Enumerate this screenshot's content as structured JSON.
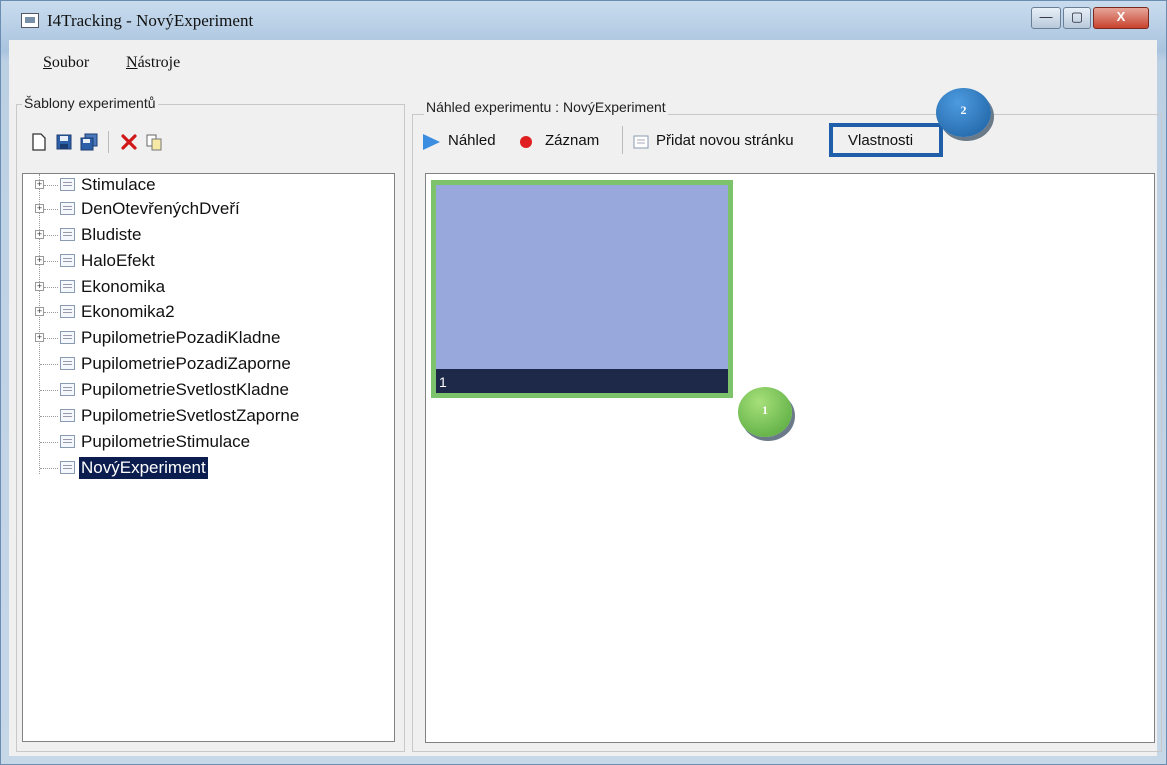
{
  "window": {
    "title": "I4Tracking - NovýExperiment",
    "minimize": "—",
    "maximize": "▢",
    "close": "X"
  },
  "menu": [
    {
      "label": "Soubor",
      "accel": "S",
      "rest": "oubor"
    },
    {
      "label": "Nástroje",
      "accel": "N",
      "rest": "ástroje"
    }
  ],
  "left_panel": {
    "title": "Šablony experimentů",
    "toolbar": [
      "new-icon",
      "save-icon",
      "save-all-icon",
      "delete-icon",
      "copy-icon"
    ],
    "tree": [
      {
        "label": "Stimulace",
        "expandable": true,
        "selected": false
      },
      {
        "label": "DenOtevřenýchDveří",
        "expandable": true,
        "selected": false
      },
      {
        "label": "Bludiste",
        "expandable": true,
        "selected": false
      },
      {
        "label": "HaloEfekt",
        "expandable": true,
        "selected": false
      },
      {
        "label": "Ekonomika",
        "expandable": true,
        "selected": false
      },
      {
        "label": "Ekonomika2",
        "expandable": true,
        "selected": false
      },
      {
        "label": "PupilometriePozadiKladne",
        "expandable": true,
        "selected": false
      },
      {
        "label": "PupilometriePozadiZaporne",
        "expandable": false,
        "selected": false
      },
      {
        "label": "PupilometrieSvetlostKladne",
        "expandable": false,
        "selected": false
      },
      {
        "label": "PupilometrieSvetlostZaporne",
        "expandable": false,
        "selected": false
      },
      {
        "label": "PupilometrieStimulace",
        "expandable": false,
        "selected": false
      },
      {
        "label": "NovýExperiment",
        "expandable": false,
        "selected": true
      }
    ]
  },
  "right_panel": {
    "title": "Náhled experimentu : NovýExperiment",
    "toolbar": {
      "preview": "Náhled",
      "record": "Záznam",
      "add_page": "Přidat novou stránku",
      "properties": "Vlastnosti"
    },
    "pages": [
      {
        "number": "1"
      }
    ],
    "callouts": {
      "one": "1",
      "two": "2"
    }
  },
  "colors": {
    "selection": "#0b1d4e",
    "thumb_border": "#7dc36b",
    "thumb_fill": "#98a7dc",
    "callout_blue": "#1f5ea8",
    "record": "#e02020",
    "play": "#3a8de0"
  }
}
